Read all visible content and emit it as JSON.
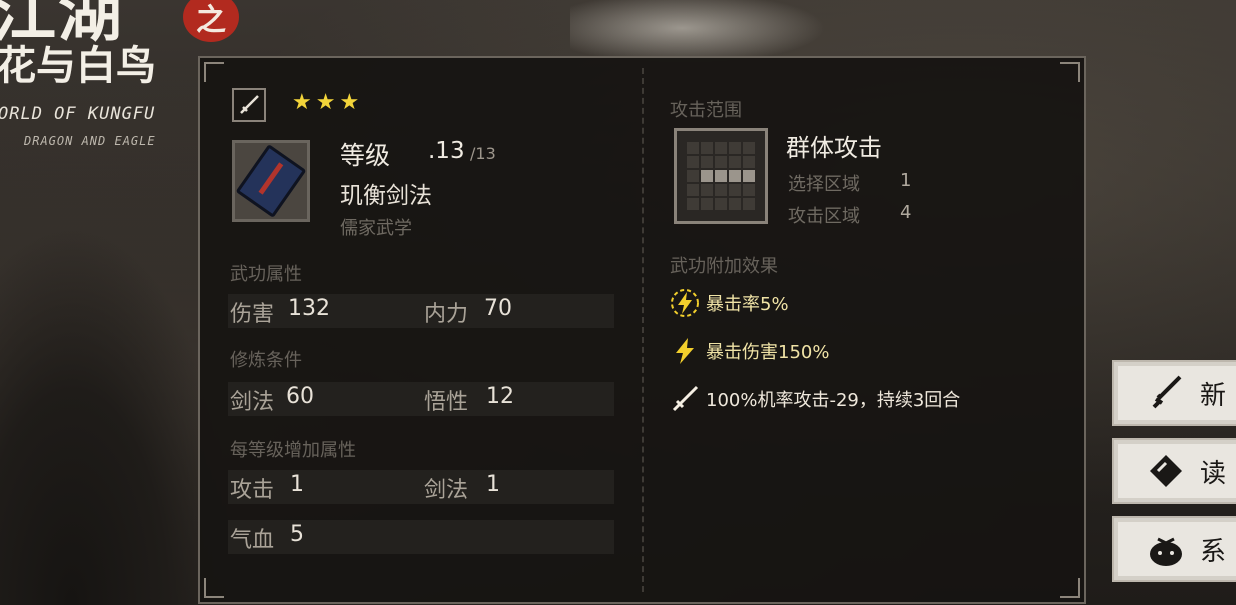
{
  "logo": {
    "title": "江湖",
    "badge": "之",
    "subtitle": "花与白鸟",
    "english_line1": "ORLD OF KUNGFU",
    "english_line2": "DRAGON AND EAGLE"
  },
  "skill": {
    "level_label": "等级",
    "level": ".13",
    "level_max": "/13",
    "name": "玑衡剑法",
    "category": "儒家武学",
    "stars": "★★★"
  },
  "attributes": {
    "title": "武功属性",
    "damage_label": "伤害",
    "damage_value": "132",
    "neili_label": "内力",
    "neili_value": "70"
  },
  "requirements": {
    "title": "修炼条件",
    "sword_label": "剑法",
    "sword_value": "60",
    "wuxing_label": "悟性",
    "wuxing_value": "12"
  },
  "per_level": {
    "title": "每等级增加属性",
    "attack_label": "攻击",
    "attack_value": "1",
    "sword_label": "剑法",
    "sword_value": "1",
    "hp_label": "气血",
    "hp_value": "5"
  },
  "attack_range": {
    "title": "攻击范围",
    "type": "群体攻击",
    "select_label": "选择区域",
    "select_value": "1",
    "attack_label": "攻击区域",
    "attack_value": "4",
    "grid_selected": [
      [
        2,
        1
      ],
      [
        2,
        2
      ],
      [
        2,
        3
      ],
      [
        2,
        4
      ]
    ]
  },
  "effects": {
    "title": "武功附加效果",
    "items": [
      {
        "icon": "lightning-circle-icon",
        "text": "暴击率5%"
      },
      {
        "icon": "lightning-icon",
        "text": "暴击伤害150%"
      },
      {
        "icon": "sword-icon",
        "text": "100%机率攻击-29，持续3回合"
      }
    ]
  },
  "side_menu": [
    {
      "icon": "sword-icon",
      "label": "新"
    },
    {
      "icon": "book-icon",
      "label": "读"
    },
    {
      "icon": "bag-icon",
      "label": "系"
    }
  ],
  "colors": {
    "accent_gold": "#f2cf2c",
    "badge_red": "#b22a1f",
    "panel_bg": "#161412"
  }
}
